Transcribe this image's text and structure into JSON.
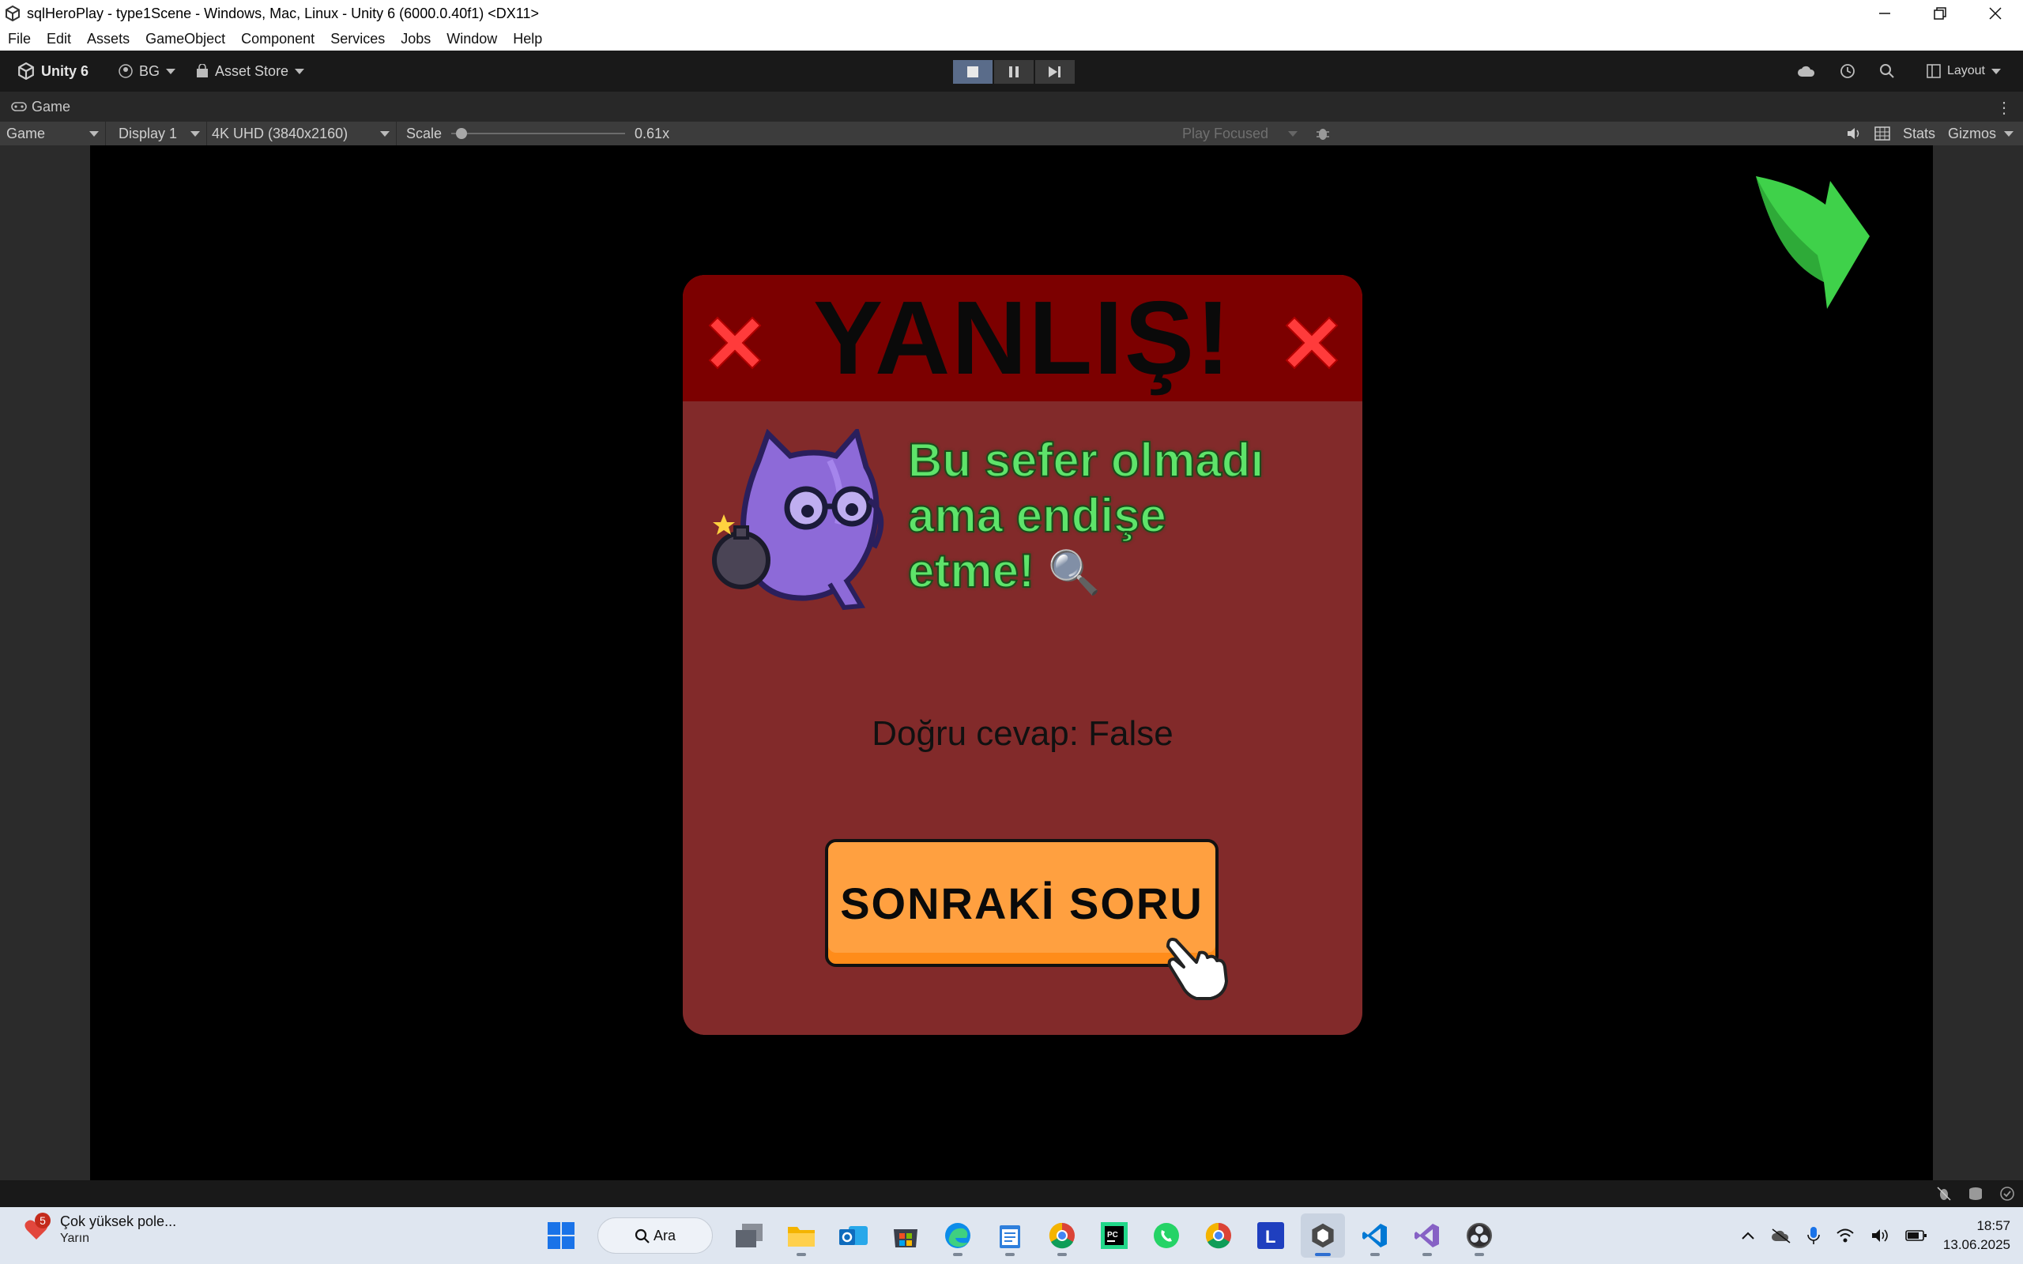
{
  "window": {
    "title": "sqlHeroPlay - type1Scene - Windows, Mac, Linux - Unity 6 (6000.0.40f1) <DX11>"
  },
  "menu": [
    "File",
    "Edit",
    "Assets",
    "GameObject",
    "Component",
    "Services",
    "Jobs",
    "Window",
    "Help"
  ],
  "toolbar": {
    "unity_label": "Unity 6",
    "account_label": "BG",
    "asset_store_label": "Asset Store",
    "layout_label": "Layout"
  },
  "tab": {
    "label": "Game"
  },
  "game_bar": {
    "view_mode": "Game",
    "display": "Display 1",
    "resolution": "4K UHD (3840x2160)",
    "scale_label": "Scale",
    "scale_value": "0.61x",
    "play_focused": "Play Focused",
    "stats_label": "Stats",
    "gizmos_label": "Gizmos"
  },
  "popup": {
    "title": "YANLIŞ!",
    "message_line1": "Bu sefer olmadı",
    "message_line2": "ama endişe",
    "message_line3": "etme!",
    "message_emoji": "🔍",
    "answer": "Doğru cevap: False",
    "next_button": "SONRAKİ SORU"
  },
  "colors": {
    "popup_body": "#822a2a",
    "popup_header": "#7c0000",
    "button": "#ffa040",
    "message_text": "#5ee36a",
    "arrow": "#3fd14a"
  },
  "taskbar": {
    "notification_title": "Çok yüksek pole...",
    "notification_subtitle": "Yarın",
    "notification_count": "5",
    "search_label": "Ara",
    "time": "18:57",
    "date": "13.06.2025"
  }
}
